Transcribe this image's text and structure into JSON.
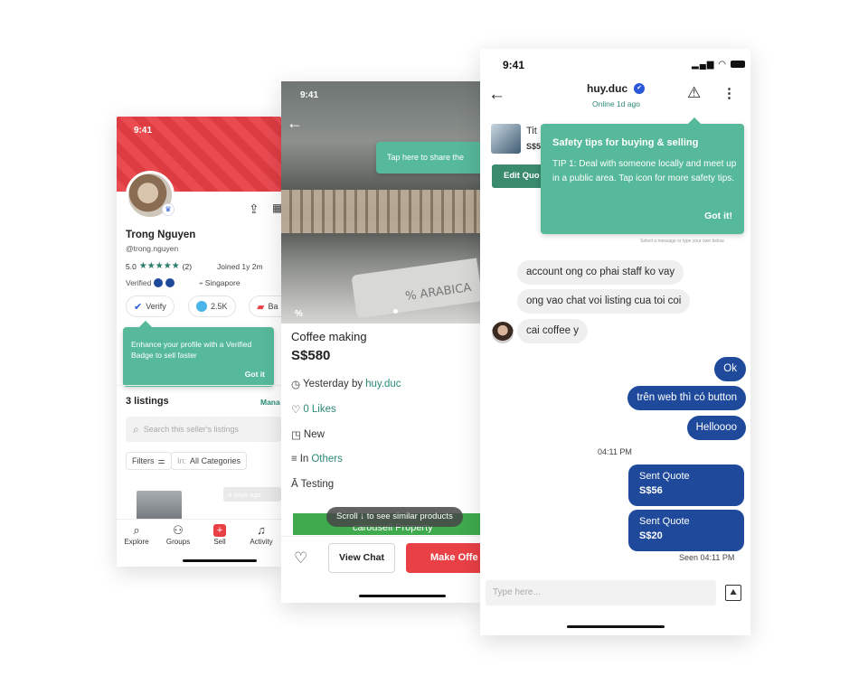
{
  "profile": {
    "time": "9:41",
    "name": "Trong Nguyen",
    "handle": "@trong.nguyen",
    "rating": "5.0",
    "stars": "★★★★★",
    "review_count": "(2)",
    "joined": "Joined 1y 2m",
    "verified_label": "Verified",
    "location": "Singapore",
    "verify_pill": "Verify",
    "coins_pill": "2.5K",
    "third_pill": "Ba",
    "tooltip_text": "Enhance your profile with a Verified Badge to sell faster",
    "tooltip_action": "Got it",
    "listings_title": "3 listings",
    "manage_link": "Mana",
    "search_placeholder": "Search this seller's listings",
    "filters_label": "Filters",
    "category_prefix": "In:",
    "category_value": "All Categories",
    "card_meta": "4 days ago",
    "nav": {
      "explore": "Explore",
      "groups": "Groups",
      "sell": "Sell",
      "activity": "Activity"
    }
  },
  "listing": {
    "time": "9:41",
    "share_tip": "Tap here to share the",
    "photo_caption": "% ARABICA",
    "title": "Coffee making",
    "price": "S$580",
    "posted_prefix": "Yesterday by",
    "seller": "huy.duc",
    "likes": "0 Likes",
    "condition": "New",
    "category_prefix": "In",
    "category": "Others",
    "description": "Testing",
    "scroll_hint": "Scroll ↓ to see similar products",
    "banner_text": "carousell Property",
    "view_chat": "View Chat",
    "make_offer": "Make Offe"
  },
  "chat": {
    "time": "9:41",
    "username": "huy.duc",
    "status": "Online 1d ago",
    "product_title_partial": "Tit",
    "product_price_partial": "S$5",
    "edit_quote": "Edit Quo",
    "safety_title": "Safety tips for buying & selling",
    "safety_body": "TIP 1: Deal with someone locally and meet up in a public area. Tap icon for more safety tips.",
    "safety_action": "Got it!",
    "small_hint": "Select a message or type your own below.",
    "messages_in": [
      "account ong co phai staff ko vay",
      "ong vao chat voi listing cua toi coi",
      "cai coffee y"
    ],
    "messages_out": [
      "Ok",
      "trên web thì có button",
      "Helloooo"
    ],
    "timestamp": "04:11 PM",
    "quotes": [
      {
        "label": "Sent Quote",
        "amount": "S$56"
      },
      {
        "label": "Sent Quote",
        "amount": "S$20"
      }
    ],
    "seen": "Seen 04:11 PM",
    "input_placeholder": "Type here..."
  },
  "colors": {
    "brand_red": "#e94046",
    "teal": "#56b99a",
    "chat_blue": "#1f4a9c"
  }
}
